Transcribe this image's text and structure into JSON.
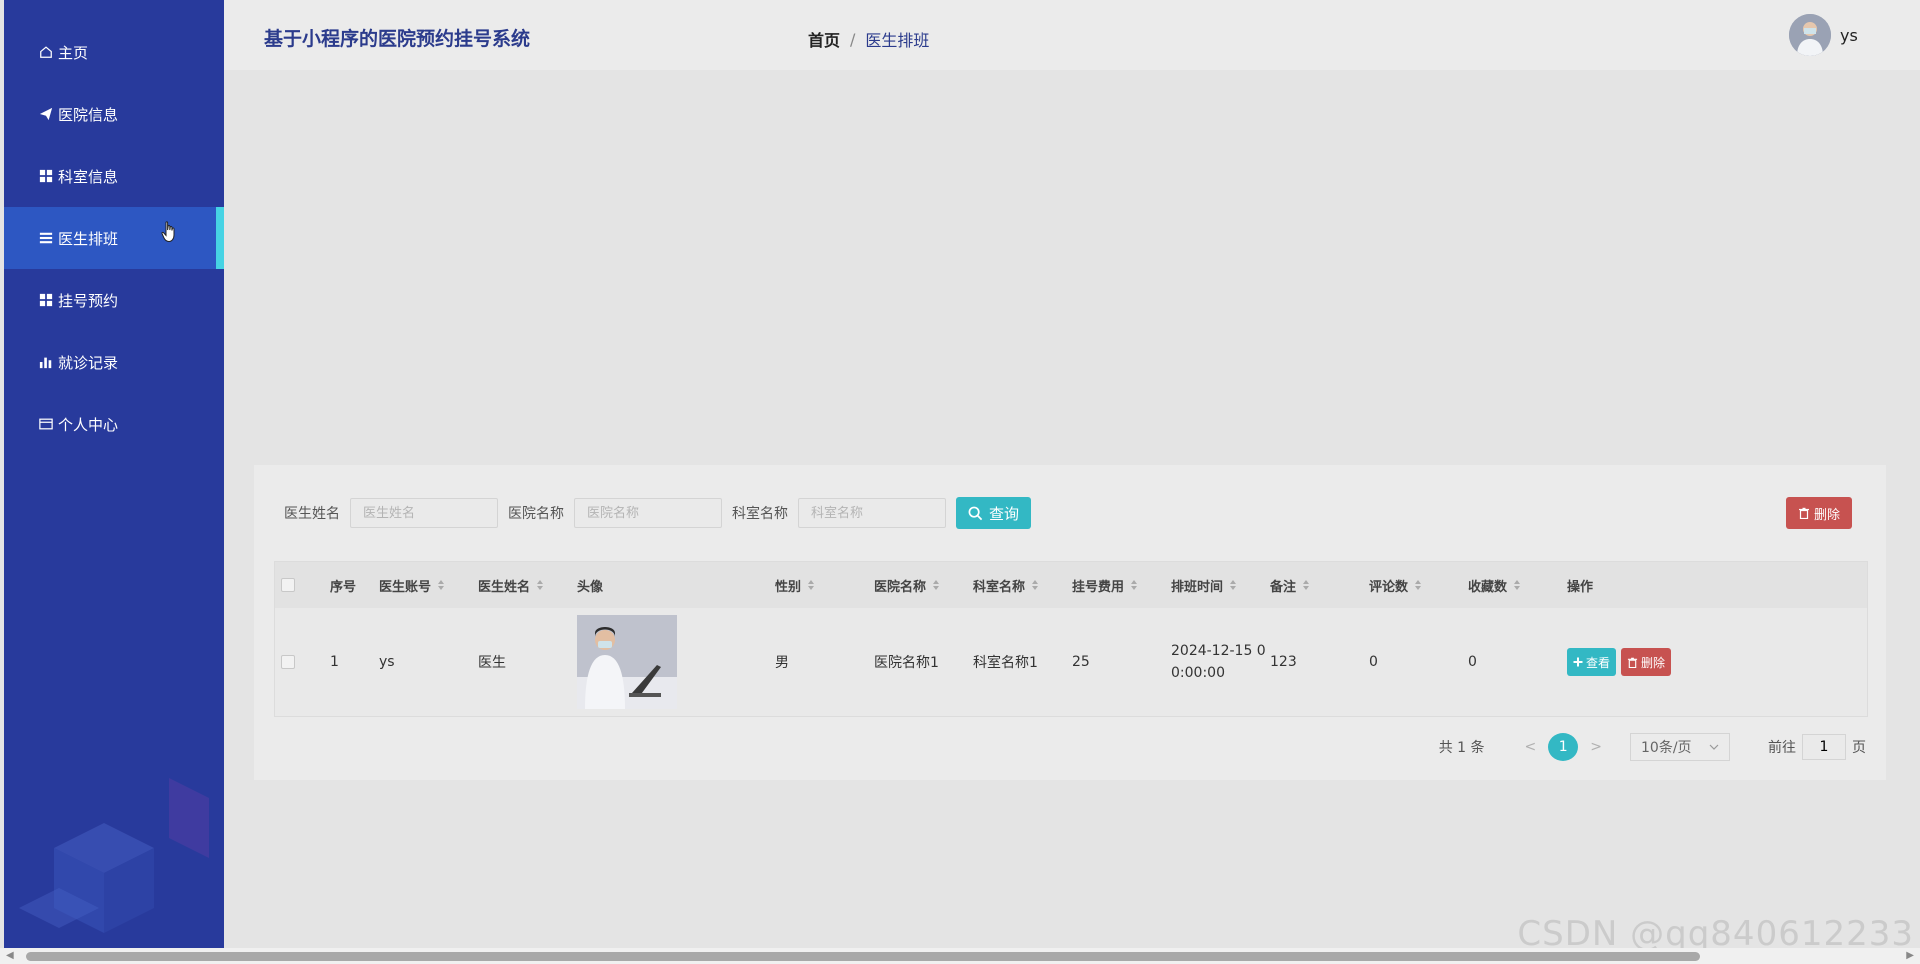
{
  "sidebar": {
    "items": [
      {
        "label": "主页",
        "icon": "home-icon"
      },
      {
        "label": "医院信息",
        "icon": "paper-plane-icon"
      },
      {
        "label": "科室信息",
        "icon": "grid-icon"
      },
      {
        "label": "医生排班",
        "icon": "list-icon",
        "active": true
      },
      {
        "label": "挂号预约",
        "icon": "grid-icon"
      },
      {
        "label": "就诊记录",
        "icon": "bar-chart-icon"
      },
      {
        "label": "个人中心",
        "icon": "card-icon"
      }
    ]
  },
  "header": {
    "title": "基于小程序的医院预约挂号系统",
    "breadcrumb": {
      "home": "首页",
      "separator": "/",
      "current": "医生排班"
    },
    "username": "ys"
  },
  "search": {
    "fields": [
      {
        "label": "医生姓名",
        "placeholder": "医生姓名"
      },
      {
        "label": "医院名称",
        "placeholder": "医院名称"
      },
      {
        "label": "科室名称",
        "placeholder": "科室名称"
      }
    ],
    "query_label": "查询",
    "delete_label": "删除"
  },
  "table": {
    "headers": [
      "序号",
      "医生账号",
      "医生姓名",
      "头像",
      "性别",
      "医院名称",
      "科室名称",
      "挂号费用",
      "排班时间",
      "备注",
      "评论数",
      "收藏数",
      "操作"
    ],
    "rows": [
      {
        "index": "1",
        "account": "ys",
        "name": "医生",
        "gender": "男",
        "hospital": "医院名称1",
        "department": "科室名称1",
        "fee": "25",
        "schedule_line1": "2024-12-15 0",
        "schedule_line2": "0:00:00",
        "remark": "123",
        "comments": "0",
        "favorites": "0",
        "view_label": "查看",
        "delete_label": "删除"
      }
    ]
  },
  "pagination": {
    "total": "共 1 条",
    "prev": "<",
    "next": ">",
    "current_page": "1",
    "page_size": "10条/页",
    "goto_prefix": "前往",
    "goto_value": "1",
    "goto_suffix": "页"
  },
  "watermark": "CSDN @qq840612233",
  "colors": {
    "sidebar": "#283a9c",
    "active_item": "#2d57c2",
    "accent": "#33b8c4",
    "danger": "#c75250"
  }
}
